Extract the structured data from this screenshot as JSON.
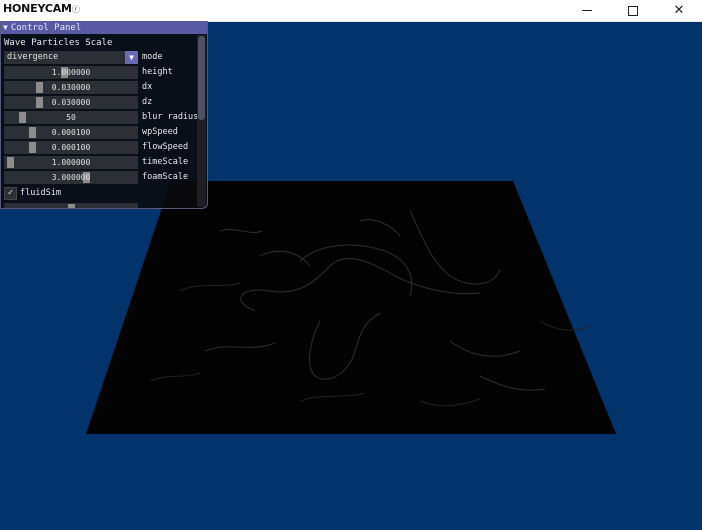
{
  "window": {
    "title": "HONEYCAM",
    "title_mark": "ⓡ",
    "minimize_glyph": "",
    "maximize_glyph": "",
    "close_glyph": "✕"
  },
  "panel": {
    "title": "Control Panel",
    "collapse_glyph": "▼",
    "section": "Wave Particles Scale",
    "mode": {
      "label": "mode",
      "value": "divergence",
      "arrow": "▼"
    },
    "sliders": [
      {
        "label": "height",
        "value": "1.000000",
        "fill": 0.45
      },
      {
        "label": "dx",
        "value": "0.030000",
        "fill": 0.25
      },
      {
        "label": "dz",
        "value": "0.030000",
        "fill": 0.25
      },
      {
        "label": "blur radius",
        "value": "50",
        "fill": 0.12
      },
      {
        "label": "wpSpeed",
        "value": "0.000100",
        "fill": 0.2
      },
      {
        "label": "flowSpeed",
        "value": "0.000100",
        "fill": 0.2
      },
      {
        "label": "timeScale",
        "value": "1.000000",
        "fill": 0.02
      },
      {
        "label": "foamScale",
        "value": "3.000000",
        "fill": 0.62
      }
    ],
    "checkbox": {
      "label": "fluidSim",
      "checked": true,
      "glyph": "✓"
    }
  },
  "colors": {
    "background": "#02336a",
    "panel_title": "#5a5aa4",
    "water_surface": "#030303"
  }
}
